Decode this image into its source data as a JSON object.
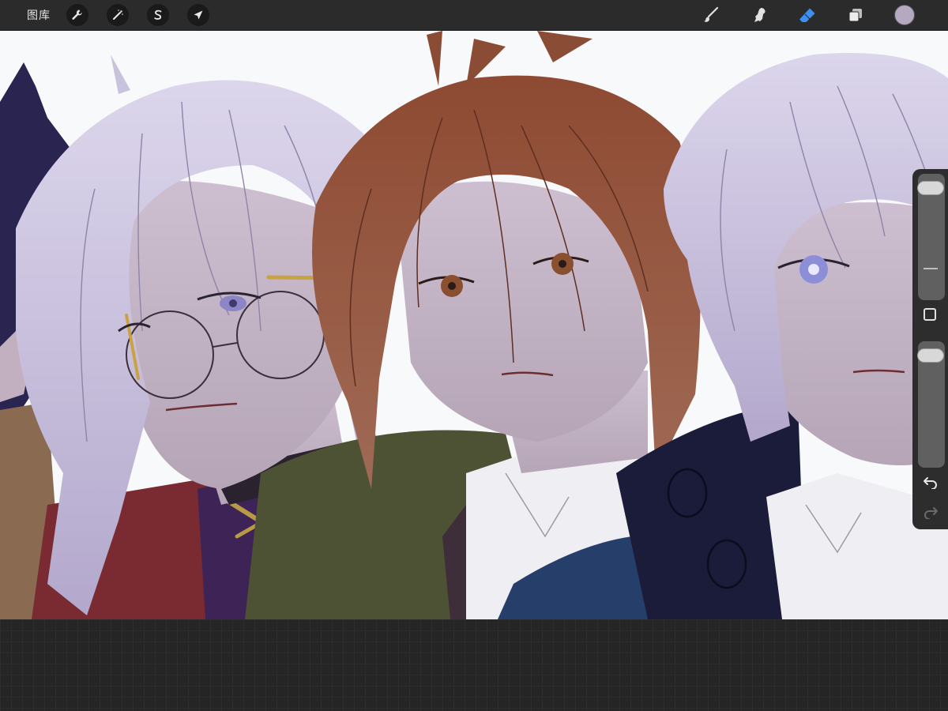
{
  "toolbar": {
    "gallery_label": "图库",
    "left_tools": [
      {
        "name": "actions-wrench-icon"
      },
      {
        "name": "adjustments-wand-icon"
      },
      {
        "name": "selection-s-icon"
      },
      {
        "name": "transform-arrow-icon"
      }
    ],
    "right_tools": [
      {
        "name": "brush-icon",
        "active": false
      },
      {
        "name": "smudge-icon",
        "active": false
      },
      {
        "name": "eraser-icon",
        "active": true
      },
      {
        "name": "layers-icon",
        "active": false
      }
    ],
    "current_color": "#b4a9c1",
    "active_tool_color": "#3d8ff0"
  },
  "sidebar": {
    "brush_size": 0.05,
    "opacity": 0.05,
    "modify_button": {
      "name": "modify-square-icon"
    },
    "undo": {
      "name": "undo-icon",
      "enabled": true
    },
    "redo": {
      "name": "redo-icon",
      "enabled": false
    }
  },
  "canvas": {
    "artwork": "illustration-four-characters",
    "palette": {
      "background": "#f8f9fa",
      "skin": "#c9b8c8",
      "silver_hair": "#c9c2dd",
      "brown_hair": "#8a4c35",
      "dark_hair": "#2a2550",
      "red_coat": "#7a2b32",
      "green_jacket": "#4d5234",
      "blue_shirt": "#263f6a",
      "navy_coat": "#1b1b3a",
      "white_shirt": "#efeef2"
    }
  }
}
